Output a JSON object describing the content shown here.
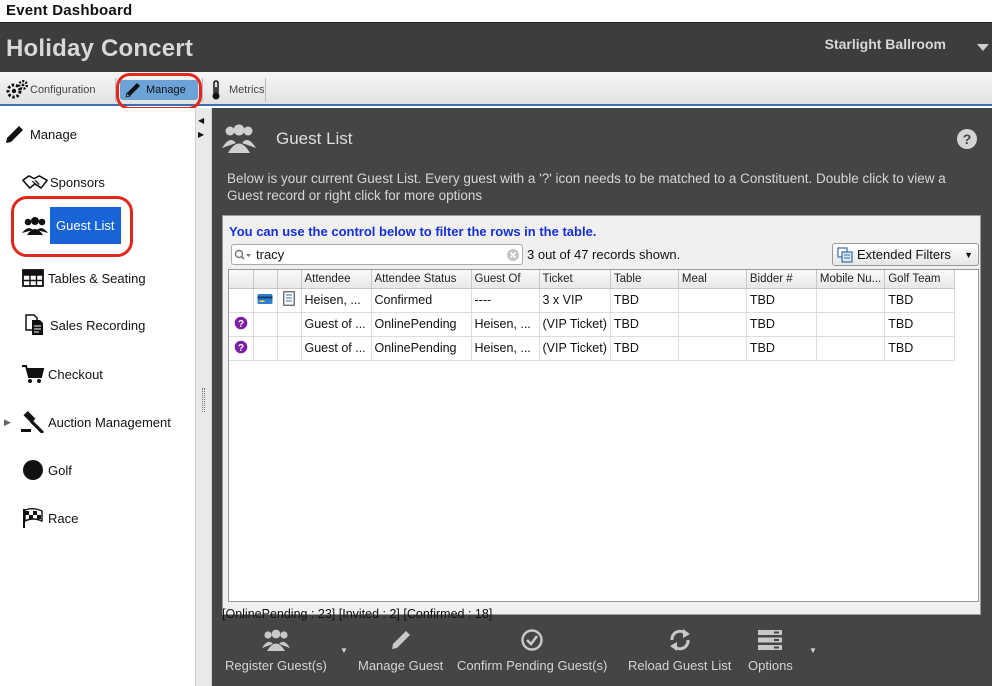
{
  "window": {
    "title": "Event Dashboard"
  },
  "header": {
    "event_title": "Holiday Concert",
    "venue": "Starlight Ballroom"
  },
  "tabs": [
    {
      "label": "Configuration",
      "icon": "gears-icon"
    },
    {
      "label": "Manage",
      "icon": "pencil-icon",
      "selected": true
    },
    {
      "label": "Metrics",
      "icon": "thermometer-icon"
    }
  ],
  "sidebar": {
    "header": {
      "label": "Manage",
      "icon": "pencil-icon"
    },
    "items": [
      {
        "label": "Sponsors",
        "icon": "handshake-icon"
      },
      {
        "label": "Guest List",
        "icon": "people-icon",
        "selected": true
      },
      {
        "label": "Tables & Seating",
        "icon": "grid-table-icon"
      },
      {
        "label": "Sales Recording",
        "icon": "documents-icon"
      },
      {
        "label": "Checkout",
        "icon": "cart-icon"
      },
      {
        "label": "Auction Management",
        "icon": "gavel-icon",
        "expandable": true
      },
      {
        "label": "Golf",
        "icon": "golf-ball-icon"
      },
      {
        "label": "Race",
        "icon": "checkered-flag-icon"
      }
    ]
  },
  "main": {
    "title": "Guest List",
    "description": "Below is your current Guest List. Every guest with a '?' icon needs to be matched to a Constituent. Double click to view a Guest record or right click for more options",
    "filter_hint": "You can use the control below to filter the rows in the table.",
    "search": {
      "value": "tracy"
    },
    "record_count": "3 out of 47 records shown.",
    "extended_filters_label": "Extended Filters",
    "table": {
      "columns": [
        "",
        "",
        "",
        "Attendee",
        "Attendee Status",
        "Guest Of",
        "Ticket",
        "Table",
        "Meal",
        "Bidder #",
        "Mobile Nu...",
        "Golf Team"
      ],
      "rows": [
        {
          "icon1": "",
          "icon2": "card-icon",
          "icon3": "document-icon",
          "cells": [
            "Heisen, ...",
            "Confirmed",
            "----",
            "3 x VIP",
            "TBD",
            "",
            "TBD",
            "",
            "TBD"
          ]
        },
        {
          "icon1": "question-icon",
          "icon2": "",
          "icon3": "",
          "cells": [
            "Guest of ...",
            "OnlinePending",
            "Heisen, ...",
            "(VIP Ticket)",
            "TBD",
            "",
            "TBD",
            "",
            "TBD"
          ]
        },
        {
          "icon1": "question-icon",
          "icon2": "",
          "icon3": "",
          "cells": [
            "Guest of ...",
            "OnlinePending",
            "Heisen, ...",
            "(VIP Ticket)",
            "TBD",
            "",
            "TBD",
            "",
            "TBD"
          ]
        }
      ]
    },
    "status_summary": "[OnlinePending : 23] [Invited : 2] [Confirmed : 18]"
  },
  "toolbar": {
    "register": "Register Guest(s)",
    "manage": "Manage Guest",
    "confirm": "Confirm Pending Guest(s)",
    "reload": "Reload Guest List",
    "options": "Options"
  },
  "colors": {
    "accent": "#1863d6",
    "highlight_ring": "#e0281c",
    "dark_panel": "#454545",
    "filter_hint": "#1530d8",
    "question_badge": "#7b1fa2"
  }
}
